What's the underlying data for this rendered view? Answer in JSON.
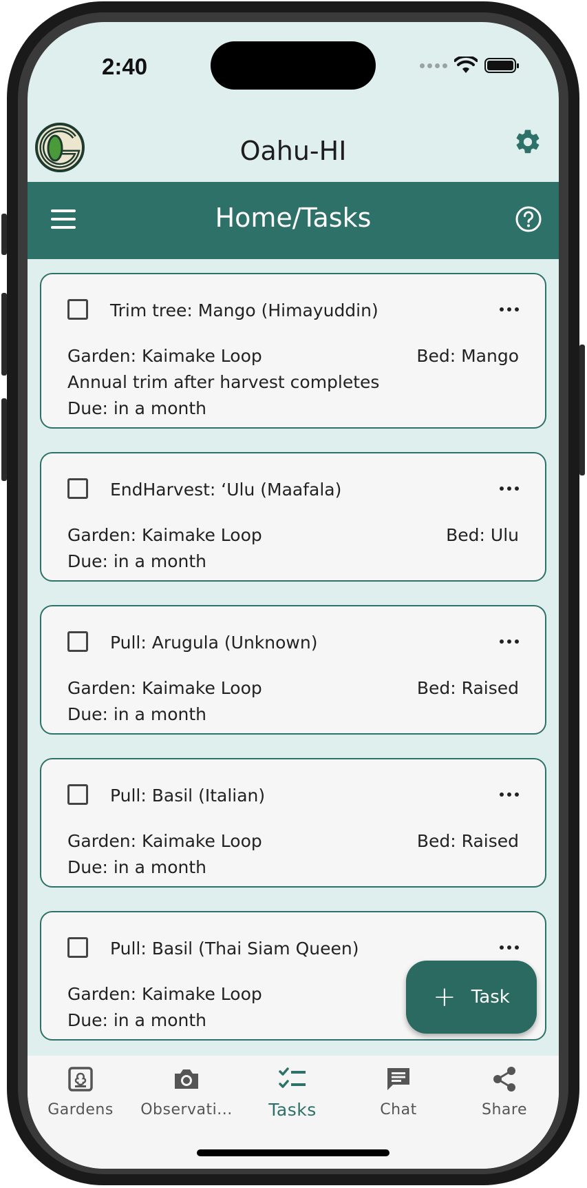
{
  "status_bar": {
    "time": "2:40"
  },
  "header": {
    "title": "Oahu-HI"
  },
  "toolbar": {
    "title": "Home/Tasks"
  },
  "tasks": [
    {
      "title": "Trim tree: Mango (Himayuddin)",
      "garden": "Garden: Kaimake Loop",
      "bed": "Bed: Mango",
      "description": "Annual trim after harvest completes",
      "due": "Due: in a month"
    },
    {
      "title": "EndHarvest: ‘Ulu (Maafala)",
      "garden": "Garden: Kaimake Loop",
      "bed": "Bed: Ulu",
      "due": "Due: in a month"
    },
    {
      "title": "Pull: Arugula (Unknown)",
      "garden": "Garden: Kaimake Loop",
      "bed": "Bed: Raised",
      "due": "Due: in a month"
    },
    {
      "title": "Pull: Basil (Italian)",
      "garden": "Garden: Kaimake Loop",
      "bed": "Bed: Raised",
      "due": "Due: in a month"
    },
    {
      "title": "Pull: Basil (Thai Siam Queen)",
      "garden": "Garden: Kaimake Loop",
      "due": "Due: in a month"
    }
  ],
  "fab": {
    "label": "Task",
    "icon": "plus-icon"
  },
  "bottom_nav": [
    {
      "label": "Gardens",
      "icon": "garden-icon"
    },
    {
      "label": "Observati...",
      "icon": "camera-icon"
    },
    {
      "label": "Tasks",
      "icon": "checklist-icon",
      "active": true
    },
    {
      "label": "Chat",
      "icon": "chat-icon"
    },
    {
      "label": "Share",
      "icon": "share-icon"
    }
  ],
  "colors": {
    "primary": "#2e7168",
    "background": "#dfefee",
    "card": "#f6f6f6"
  }
}
